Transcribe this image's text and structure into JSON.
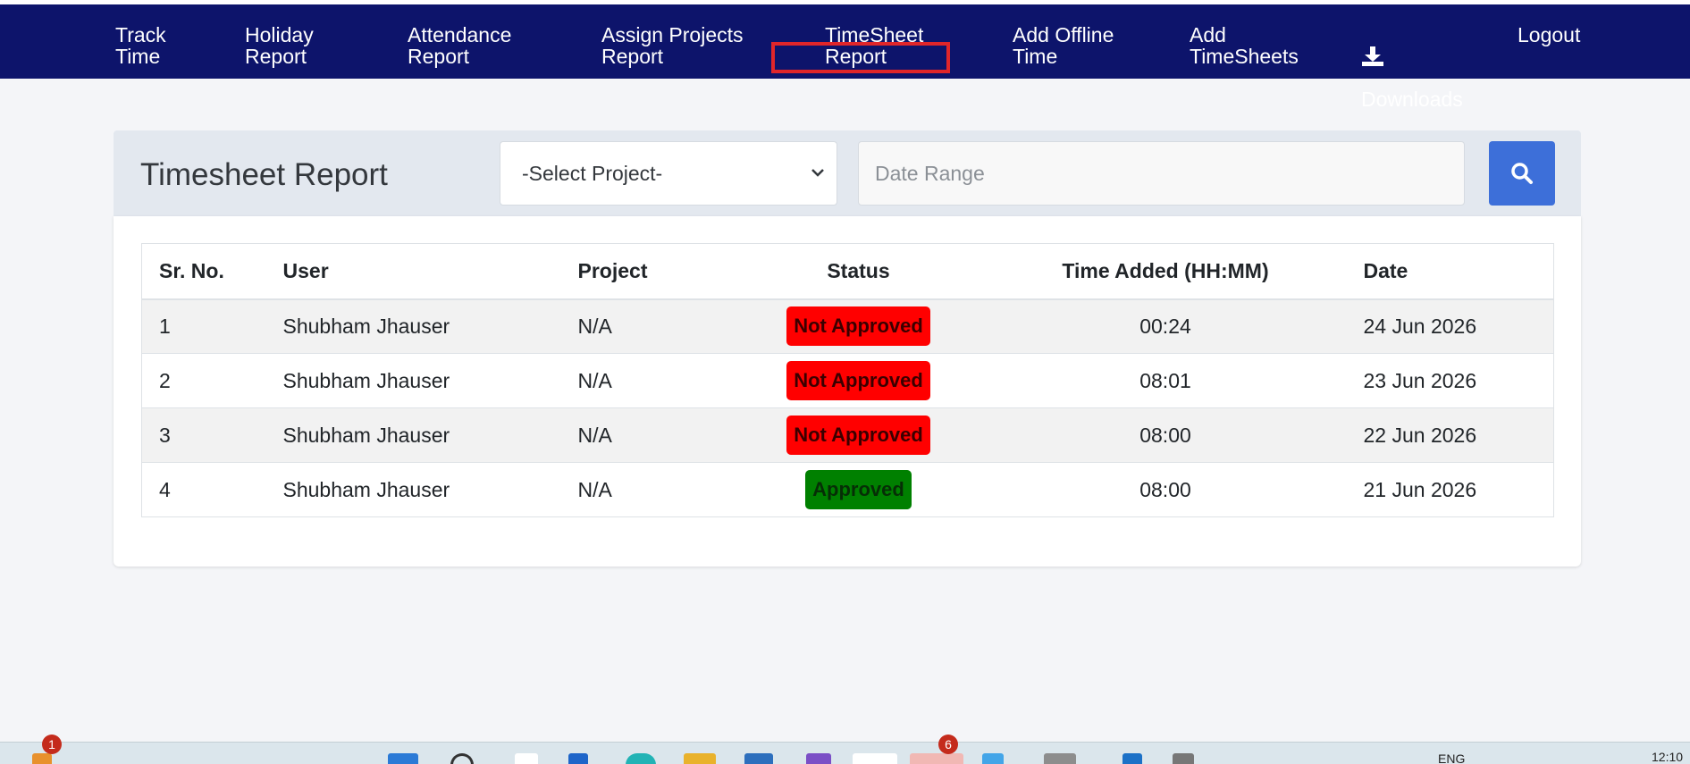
{
  "nav": {
    "items": [
      {
        "id": "track-time",
        "label": "Track\nTime"
      },
      {
        "id": "holiday-report",
        "label": "Holiday\nReport"
      },
      {
        "id": "attendance-report",
        "label": "Attendance\nReport"
      },
      {
        "id": "assign-projects-report",
        "label": "Assign Projects\nReport"
      },
      {
        "id": "timesheet-report",
        "label": "TimeSheet\nReport"
      },
      {
        "id": "add-offline-time",
        "label": "Add Offline\nTime"
      },
      {
        "id": "add-timesheets",
        "label": "Add\nTimeSheets"
      },
      {
        "id": "downloads",
        "label": "Downloads",
        "icon": "download-icon"
      },
      {
        "id": "logout",
        "label": "Logout"
      }
    ],
    "highlighted": "timesheet-report",
    "colors": {
      "background": "#0d146b",
      "highlight": "#e0262a"
    }
  },
  "page": {
    "title": "Timesheet Report",
    "project_select": {
      "selected": "-Select Project-"
    },
    "date_range": {
      "placeholder": "Date Range",
      "value": ""
    },
    "search_button": {
      "icon": "search-icon",
      "color": "#3d6fd9"
    }
  },
  "table": {
    "headers": [
      "Sr. No.",
      "User",
      "Project",
      "Status",
      "Time Added (HH:MM)",
      "Date"
    ],
    "rows": [
      {
        "sr": "1",
        "user": "Shubham Jhauser",
        "project": "N/A",
        "status": "Not Approved",
        "time": "00:24",
        "date": "24 Jun 2026"
      },
      {
        "sr": "2",
        "user": "Shubham Jhauser",
        "project": "N/A",
        "status": "Not Approved",
        "time": "08:01",
        "date": "23 Jun 2026"
      },
      {
        "sr": "3",
        "user": "Shubham Jhauser",
        "project": "N/A",
        "status": "Not Approved",
        "time": "08:00",
        "date": "22 Jun 2026"
      },
      {
        "sr": "4",
        "user": "Shubham Jhauser",
        "project": "N/A",
        "status": "Approved",
        "time": "08:00",
        "date": "21 Jun 2026"
      }
    ],
    "status_colors": {
      "Not Approved": "#ff0000",
      "Approved": "#008000"
    }
  },
  "taskbar": {
    "left_badge": "1",
    "app_badge": "6",
    "lang": "ENG",
    "clock": "12:10"
  }
}
